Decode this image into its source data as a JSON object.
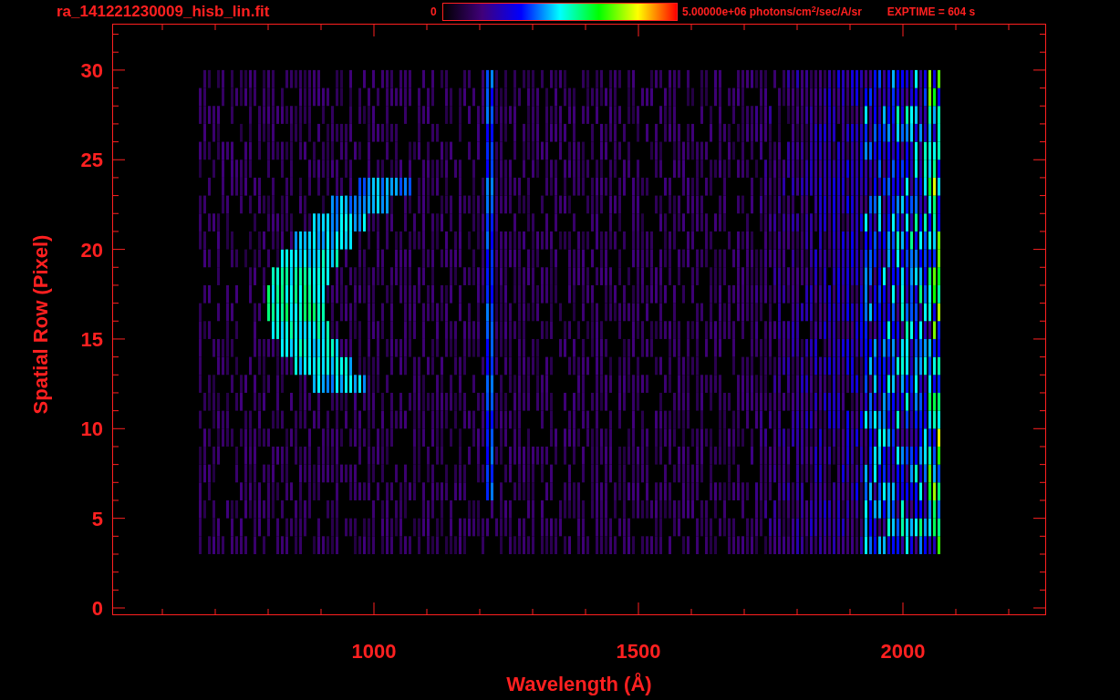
{
  "header": {
    "filename": "ra_141221230009_hisb_lin.fit",
    "colorbar_min": "0",
    "colorbar_max": "5.00000e+06 photons/cm$^{2}$/sec/A/sr",
    "exposure": "EXPTIME = 604 s"
  },
  "plot": {
    "xlabel": "Wavelength (Å)",
    "ylabel": "Spatial Row (Pixel)",
    "xticks": [
      "1000",
      "1500",
      "2000"
    ],
    "yticks": [
      "30",
      "25",
      "20",
      "15",
      "10",
      "5",
      "0"
    ]
  }
}
